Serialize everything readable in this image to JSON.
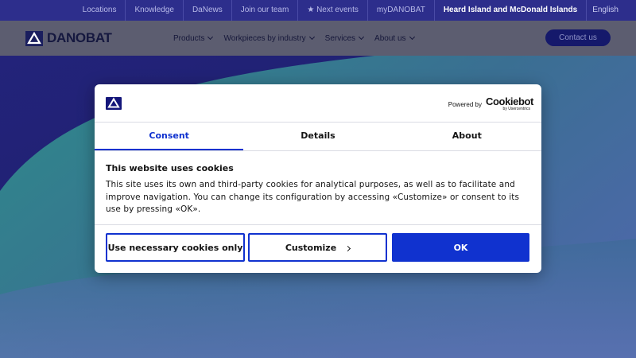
{
  "topbar": {
    "links": [
      "Locations",
      "Knowledge",
      "DaNews",
      "Join our team",
      "★ Next events",
      "myDANOBAT"
    ],
    "country": "Heard Island and McDonald Islands",
    "language": "English"
  },
  "header": {
    "logo_text": "DANOBAT",
    "nav": [
      "Products",
      "Workpieces by industry",
      "Services",
      "About us"
    ],
    "contact_label": "Contact us"
  },
  "cookie_dialog": {
    "powered_by": "Powered by",
    "brand": "Cookiebot",
    "brand_sub": "by Usercentrics",
    "tabs": [
      "Consent",
      "Details",
      "About"
    ],
    "active_tab": "Consent",
    "title": "This website uses cookies",
    "text": "This site uses its own and third-party cookies for analytical purposes, as well as to facilitate and improve navigation. You can change its configuration by accessing «Customize» or consent to its use by pressing «OK».",
    "buttons": {
      "necessary": "Use necessary cookies only",
      "customize": "Customize",
      "ok": "OK"
    }
  },
  "colors": {
    "accent": "#1032cf",
    "topbar_bg": "#2d2e8c",
    "hero_blue": "#1d2069",
    "hero_teal": "#2f7f86"
  },
  "icons": {
    "logo": "danobat-triangle-icon",
    "customize_chevron": "chevron-right-icon",
    "nav_chevron": "chevron-down-icon"
  }
}
